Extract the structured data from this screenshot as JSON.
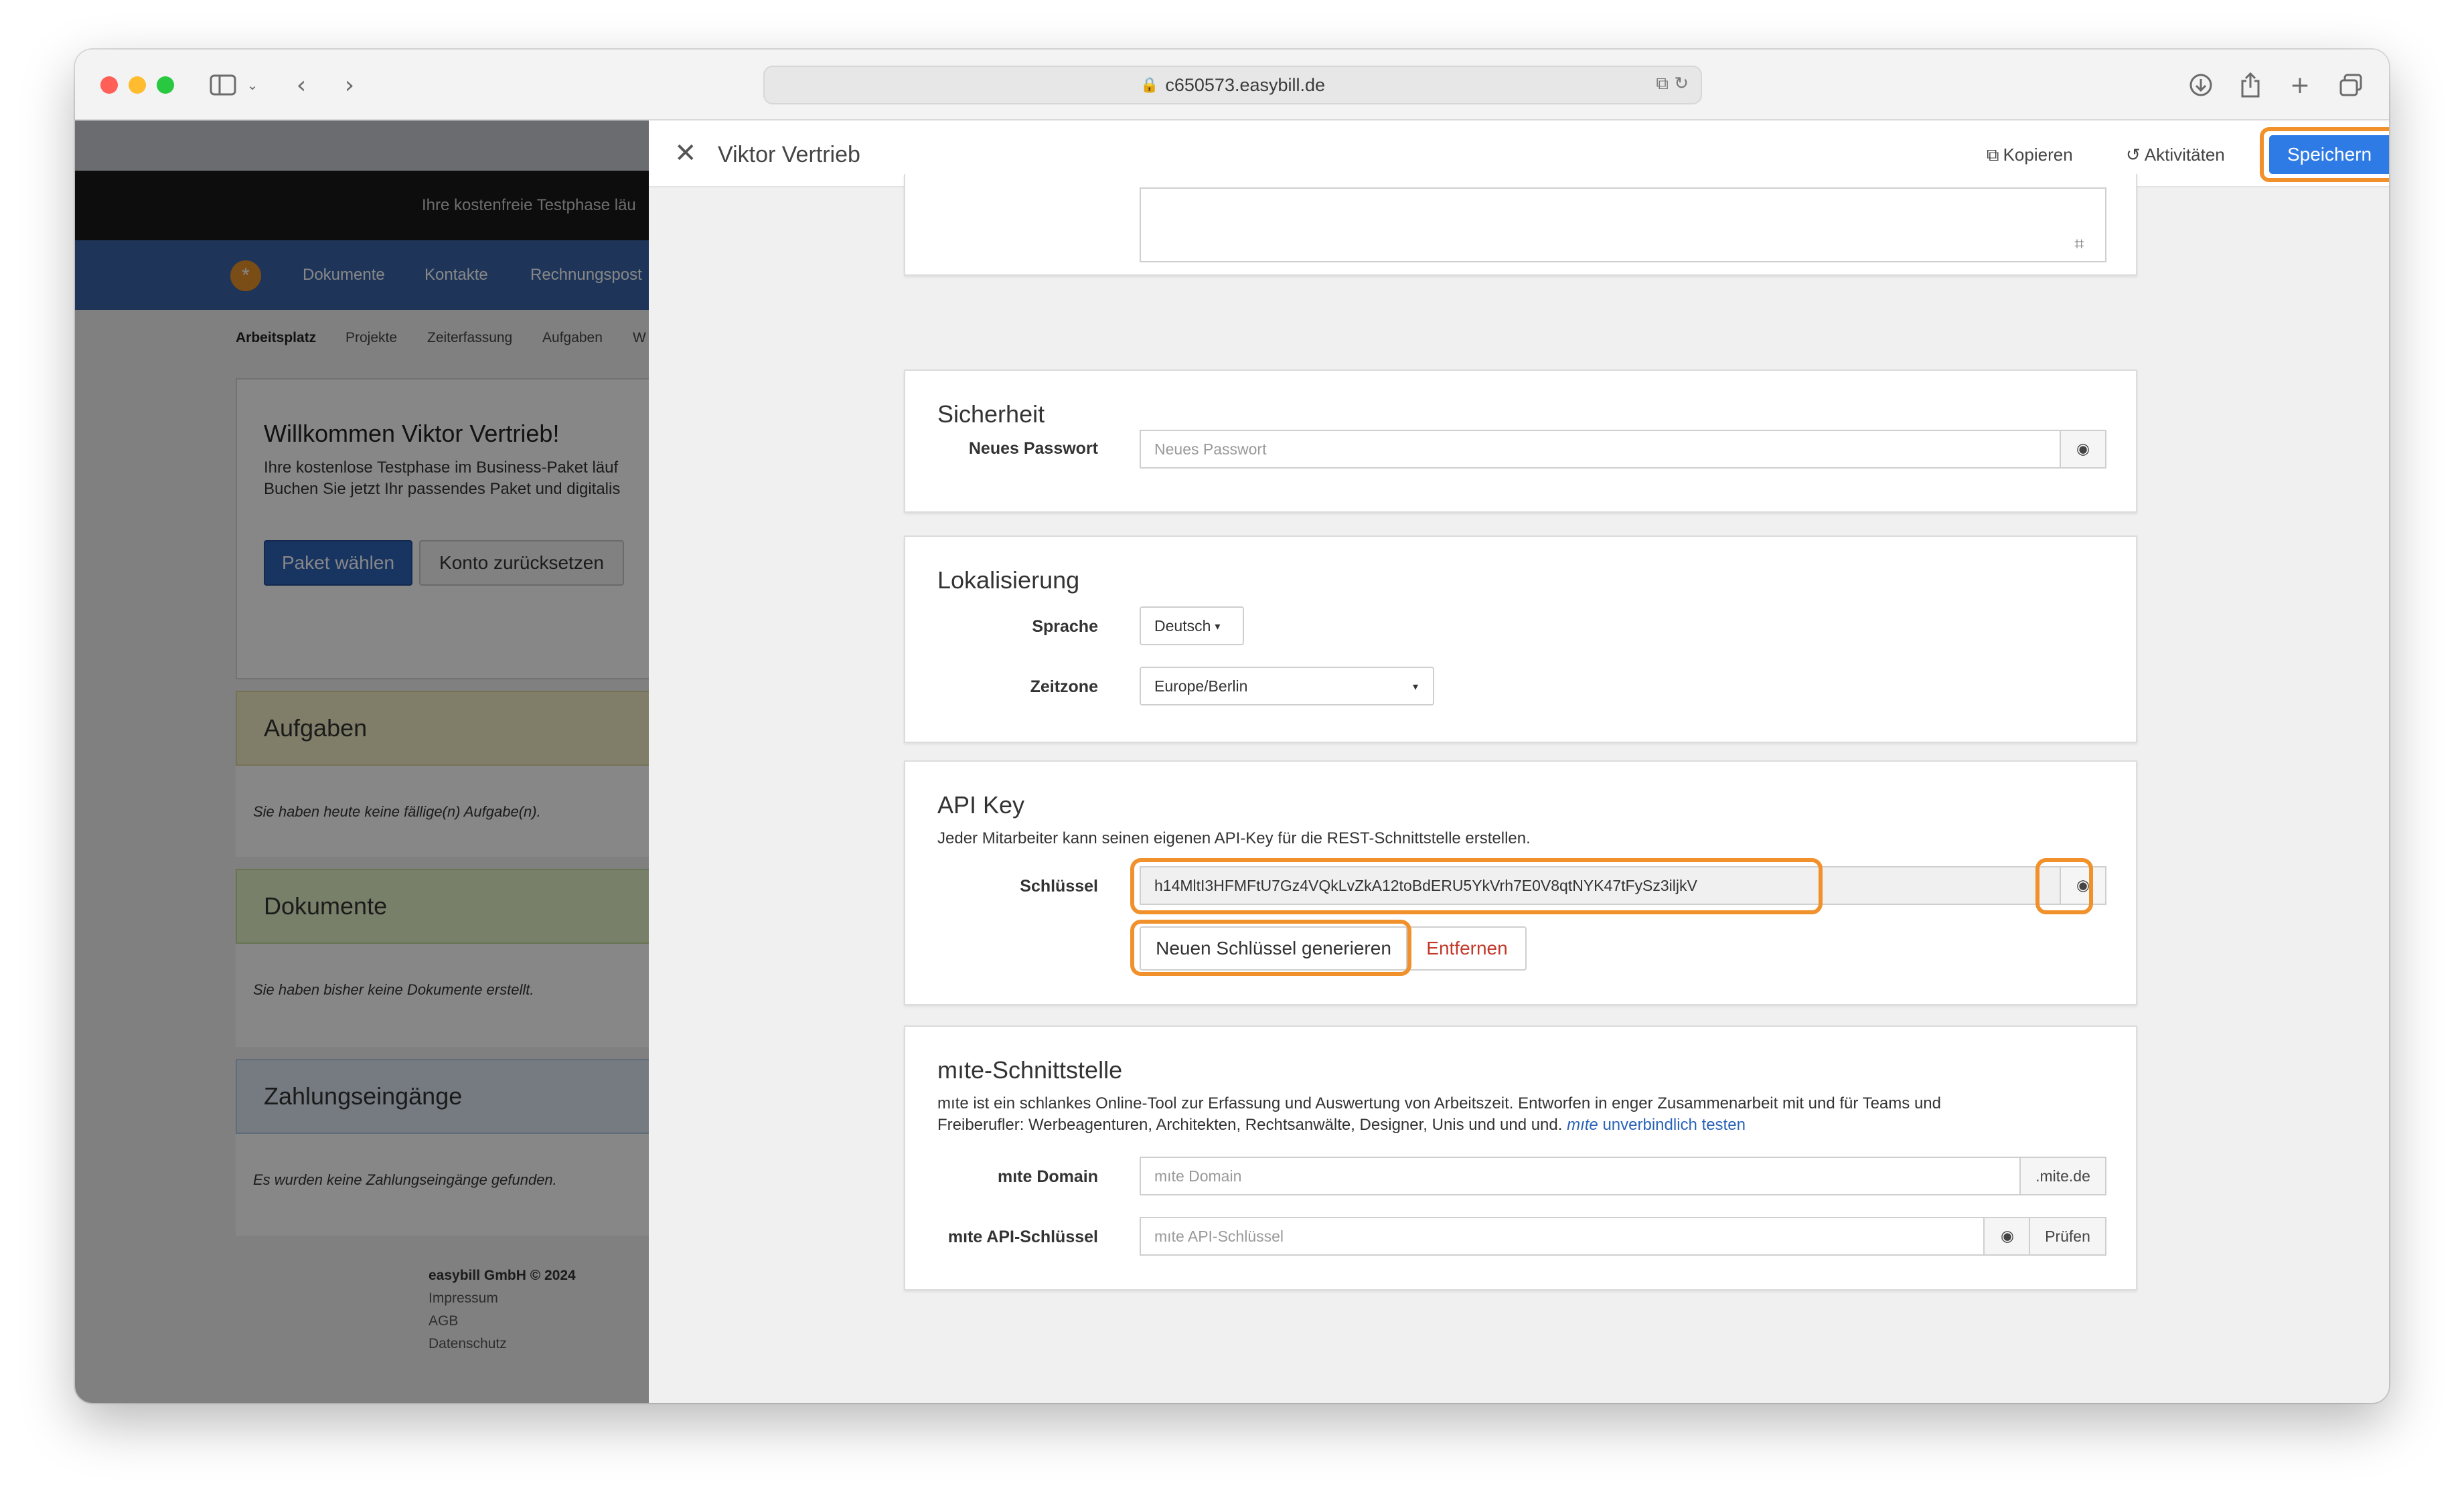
{
  "browser": {
    "url": "c650573.easybill.de"
  },
  "background_app": {
    "trial_banner": "Ihre kostenfreie Testphase läu",
    "nav": [
      "Dokumente",
      "Kontakte",
      "Rechnungspost"
    ],
    "subnav": [
      "Arbeitsplatz",
      "Projekte",
      "Zeiterfassung",
      "Aufgaben",
      "W"
    ],
    "welcome": {
      "title": "Willkommen Viktor Vertrieb!",
      "line1": "Ihre kostenlose Testphase im Business-Paket läuf",
      "line2": "Buchen Sie jetzt Ihr passendes Paket und digitalis",
      "primary_button": "Paket wählen",
      "secondary_button": "Konto zurücksetzen"
    },
    "sections": [
      {
        "title": "Aufgaben",
        "message": "Sie haben heute keine fällige(n) Aufgabe(n).",
        "color": "#f1efc4"
      },
      {
        "title": "Dokumente",
        "message": "Sie haben bisher keine Dokumente erstellt.",
        "color": "#e2f2c8"
      },
      {
        "title": "Zahlungseingänge",
        "message": "Es wurden keine Zahlungseingänge gefunden.",
        "color": "#dde9f3"
      }
    ],
    "footer": {
      "copyright": "easybill GmbH © 2024",
      "links": [
        "Impressum",
        "AGB",
        "Datenschutz"
      ]
    }
  },
  "panel": {
    "title": "Viktor Vertrieb",
    "copy_label": "Kopieren",
    "activity_label": "Aktivitäten",
    "save_label": "Speichern",
    "accent_color": "#2f7be5",
    "highlight_color": "#f0912b",
    "security": {
      "title": "Sicherheit",
      "password_label": "Neues Passwort",
      "password_placeholder": "Neues Passwort"
    },
    "localization": {
      "title": "Lokalisierung",
      "language_label": "Sprache",
      "language_value": "Deutsch",
      "timezone_label": "Zeitzone",
      "timezone_value": "Europe/Berlin"
    },
    "api_key": {
      "title": "API Key",
      "description": "Jeder Mitarbeiter kann seinen eigenen API-Key für die REST-Schnittstelle erstellen.",
      "key_label": "Schlüssel",
      "key_value": "h14MltI3HFMFtU7Gz4VQkLvZkA12toBdERU5YkVrh7E0V8qtNYK47tFySz3iljkV",
      "generate_button": "Neuen Schlüssel generieren",
      "remove_button": "Entfernen"
    },
    "mite": {
      "title": "mıte-Schnittstelle",
      "desc_line1": "mıte ist ein schlankes Online-Tool zur Erfassung und Auswertung von Arbeitszeit. Entworfen in enger Zusammenarbeit mit und für Teams und",
      "desc_line2": "Freiberufler: Werbeagenturen, Architekten, Rechtsanwälte, Designer, Unis und und und.",
      "link_brand": "mıte",
      "link_text": "unverbindlich testen",
      "domain_label": "mıte Domain",
      "domain_placeholder": "mıte Domain",
      "domain_suffix": ".mite.de",
      "api_label": "mıte API-Schlüssel",
      "api_placeholder": "mıte API-Schlüssel",
      "check_button": "Prüfen"
    }
  }
}
